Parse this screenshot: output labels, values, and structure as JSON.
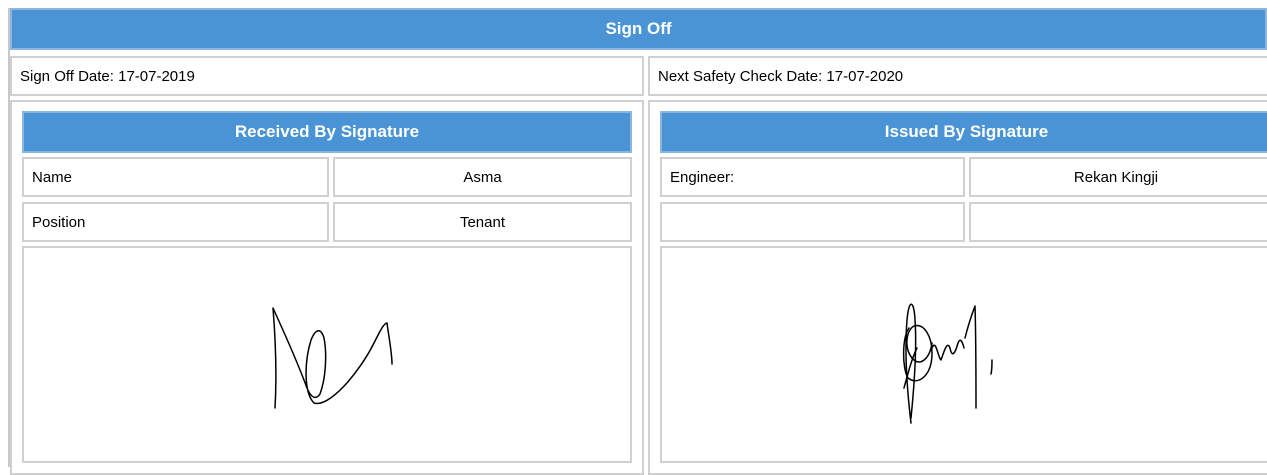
{
  "sign_off": {
    "title": "Sign Off",
    "sign_off_date": "Sign Off Date: 17-07-2019",
    "next_safety_check_date": "Next Safety Check Date: 17-07-2020"
  },
  "received_by": {
    "title": "Received By Signature",
    "name_label": "Name",
    "name_value": "Asma",
    "position_label": "Position",
    "position_value": "Tenant"
  },
  "issued_by": {
    "title": "Issued By Signature",
    "engineer_label": "Engineer:",
    "engineer_value": "Rekan Kingji",
    "row2_label": "",
    "row2_value": ""
  },
  "colors": {
    "header_blue": "#4a94d6",
    "border_grey": "#d0d0d0"
  }
}
